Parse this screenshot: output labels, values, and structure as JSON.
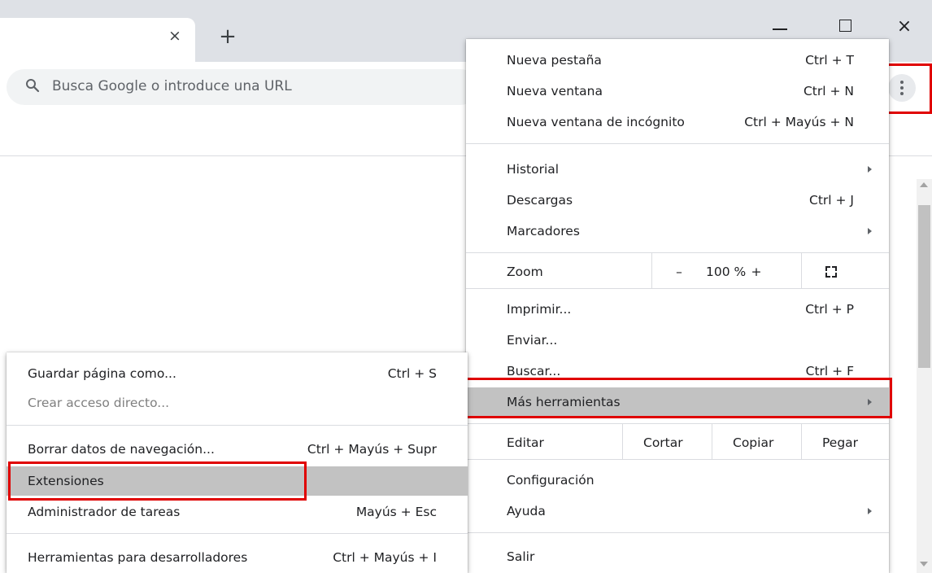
{
  "browser": {
    "tab_close_glyph": "×",
    "new_tab_glyph": "+",
    "close_window_glyph": "×",
    "omnibox_placeholder": "Busca Google o introduce una URL"
  },
  "main_menu": {
    "new_tab": {
      "label": "Nueva pestaña",
      "shortcut": "Ctrl + T"
    },
    "new_window": {
      "label": "Nueva ventana",
      "shortcut": "Ctrl + N"
    },
    "incognito": {
      "label": "Nueva ventana de incógnito",
      "shortcut": "Ctrl + Mayús + N"
    },
    "history": {
      "label": "Historial"
    },
    "downloads": {
      "label": "Descargas",
      "shortcut": "Ctrl + J"
    },
    "bookmarks": {
      "label": "Marcadores"
    },
    "zoom": {
      "label": "Zoom",
      "minus": "–",
      "value": "100 %",
      "plus": "+"
    },
    "print": {
      "label": "Imprimir...",
      "shortcut": "Ctrl + P"
    },
    "cast": {
      "label": "Enviar..."
    },
    "find": {
      "label": "Buscar...",
      "shortcut": "Ctrl + F"
    },
    "more_tools": {
      "label": "Más herramientas"
    },
    "edit": {
      "label": "Editar",
      "cut": "Cortar",
      "copy": "Copiar",
      "paste": "Pegar"
    },
    "settings": {
      "label": "Configuración"
    },
    "help": {
      "label": "Ayuda"
    },
    "exit": {
      "label": "Salir"
    }
  },
  "sub_menu": {
    "save_page": {
      "label": "Guardar página como...",
      "shortcut": "Ctrl + S"
    },
    "create_shortcut": {
      "label": "Crear acceso directo..."
    },
    "clear_data": {
      "label": "Borrar datos de navegación...",
      "shortcut": "Ctrl + Mayús + Supr"
    },
    "extensions": {
      "label": "Extensiones"
    },
    "task_manager": {
      "label": "Administrador de tareas",
      "shortcut": "Mayús + Esc"
    },
    "dev_tools": {
      "label": "Herramientas para desarrolladores",
      "shortcut": "Ctrl + Mayús + I"
    }
  },
  "colors": {
    "highlight": "#c2c2c2",
    "annotation_red": "#e00000",
    "tabstrip": "#dee1e6"
  }
}
